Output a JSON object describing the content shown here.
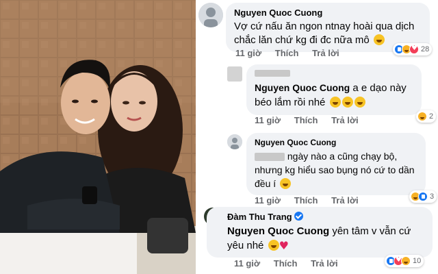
{
  "photo": {
    "alt_subject": "couple-selfie"
  },
  "comments": [
    {
      "author": "Nguyen Quoc Cuong",
      "text": "Vợ cứ nấu ăn ngon ntnay hoài qua dịch chắc lăn chứ kg đi đc nữa mô",
      "time": "11 giờ",
      "like_label": "Thích",
      "reply_label": "Trả lời",
      "reaction_count": "28"
    },
    {
      "mention": "Nguyen Quoc Cuong",
      "text": "a e dạo này béo lắm rồi nhé",
      "time": "11 giờ",
      "like_label": "Thích",
      "reply_label": "Trả lời",
      "reaction_count": "2"
    },
    {
      "author": "Nguyen Quoc Cuong",
      "text_line1": "ngày nào a cũng chạy bộ,",
      "text_rest": "nhưng kg hiểu sao bụng nó cứ to dần đều í",
      "time": "11 giờ",
      "like_label": "Thích",
      "reply_label": "Trả lời",
      "reaction_count": "3"
    },
    {
      "author": "Đàm Thu Trang",
      "mention": "Nguyen Quoc Cuong",
      "text": "yên tâm v vẫn cứ yêu nhé",
      "time": "11 giờ",
      "like_label": "Thích",
      "reply_label": "Trả lời",
      "reaction_count": "10"
    }
  ],
  "colors": {
    "name": "#050505",
    "meta": "#65676b",
    "bubble": "#f0f2f5",
    "like": "#1877f2",
    "love": "#f33e58",
    "haha": "#f7b125"
  }
}
